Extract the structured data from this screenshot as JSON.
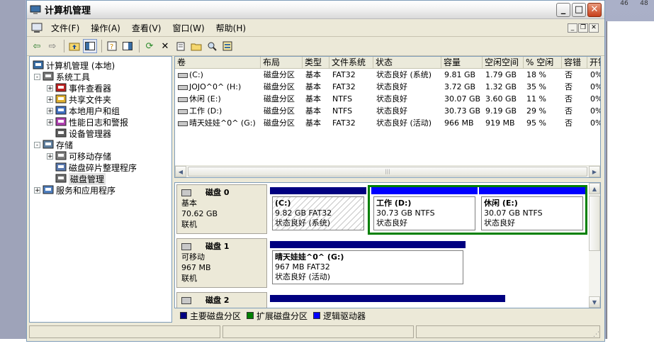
{
  "window": {
    "title": "计算机管理"
  },
  "menu": [
    "文件(F)",
    "操作(A)",
    "查看(V)",
    "窗口(W)",
    "帮助(H)"
  ],
  "toolbar_icons": [
    "back-icon",
    "forward-icon",
    "up-folder-icon",
    "show-hide-tree-icon",
    "properties-icon",
    "help-icon",
    "refresh-icon",
    "delete-icon",
    "open-icon",
    "folder-icon",
    "search-icon",
    "export-icon"
  ],
  "tree": [
    {
      "label": "计算机管理 (本地)",
      "level": 0,
      "exp": "",
      "icon": "computer-icon"
    },
    {
      "label": "系统工具",
      "level": 1,
      "exp": "-",
      "icon": "tools-icon"
    },
    {
      "label": "事件查看器",
      "level": 2,
      "exp": "+",
      "icon": "event-viewer-icon"
    },
    {
      "label": "共享文件夹",
      "level": 2,
      "exp": "+",
      "icon": "shared-folder-icon"
    },
    {
      "label": "本地用户和组",
      "level": 2,
      "exp": "+",
      "icon": "users-icon"
    },
    {
      "label": "性能日志和警报",
      "level": 2,
      "exp": "+",
      "icon": "performance-icon"
    },
    {
      "label": "设备管理器",
      "level": 2,
      "exp": "",
      "icon": "device-manager-icon"
    },
    {
      "label": "存储",
      "level": 1,
      "exp": "-",
      "icon": "storage-icon"
    },
    {
      "label": "可移动存储",
      "level": 2,
      "exp": "+",
      "icon": "removable-storage-icon"
    },
    {
      "label": "磁盘碎片整理程序",
      "level": 2,
      "exp": "",
      "icon": "defrag-icon"
    },
    {
      "label": "磁盘管理",
      "level": 2,
      "exp": "",
      "icon": "disk-management-icon",
      "selected": true
    },
    {
      "label": "服务和应用程序",
      "level": 1,
      "exp": "+",
      "icon": "services-icon"
    }
  ],
  "volumes": {
    "columns": [
      "卷",
      "布局",
      "类型",
      "文件系统",
      "状态",
      "容量",
      "空闲空间",
      "% 空闲",
      "容错",
      "开销"
    ],
    "rows": [
      [
        "(C:)",
        "磁盘分区",
        "基本",
        "FAT32",
        "状态良好 (系统)",
        "9.81 GB",
        "1.79 GB",
        "18 %",
        "否",
        "0%"
      ],
      [
        "JOJO^0^ (H:)",
        "磁盘分区",
        "基本",
        "FAT32",
        "状态良好",
        "3.72 GB",
        "1.32 GB",
        "35 %",
        "否",
        "0%"
      ],
      [
        "休闲 (E:)",
        "磁盘分区",
        "基本",
        "NTFS",
        "状态良好",
        "30.07 GB",
        "3.60 GB",
        "11 %",
        "否",
        "0%"
      ],
      [
        "工作 (D:)",
        "磁盘分区",
        "基本",
        "NTFS",
        "状态良好",
        "30.73 GB",
        "9.19 GB",
        "29 %",
        "否",
        "0%"
      ],
      [
        "晴天娃娃^0^ (G:)",
        "磁盘分区",
        "基本",
        "FAT32",
        "状态良好 (活动)",
        "966 MB",
        "919 MB",
        "95 %",
        "否",
        "0%"
      ]
    ]
  },
  "disks": [
    {
      "name": "磁盘 0",
      "type": "基本",
      "size": "70.62 GB",
      "status": "联机",
      "partitions": [
        {
          "name": "(C:)",
          "size": "9.82 GB FAT32",
          "status": "状态良好 (系统)"
        },
        {
          "name": "工作  (D:)",
          "size": "30.73 GB NTFS",
          "status": "状态良好"
        },
        {
          "name": "休闲  (E:)",
          "size": "30.07 GB NTFS",
          "status": "状态良好"
        }
      ]
    },
    {
      "name": "磁盘 1",
      "type": "可移动",
      "size": "967 MB",
      "status": "联机",
      "partitions": [
        {
          "name": "晴天娃娃^0^  (G:)",
          "size": "967 MB FAT32",
          "status": "状态良好 (活动)"
        }
      ]
    },
    {
      "name": "磁盘 2"
    }
  ],
  "legend": [
    {
      "label": "主要磁盘分区",
      "color": "#000080"
    },
    {
      "label": "扩展磁盘分区",
      "color": "#008000"
    },
    {
      "label": "逻辑驱动器",
      "color": "#0000ff"
    }
  ],
  "background": {
    "numbers": [
      "46",
      "48"
    ]
  }
}
